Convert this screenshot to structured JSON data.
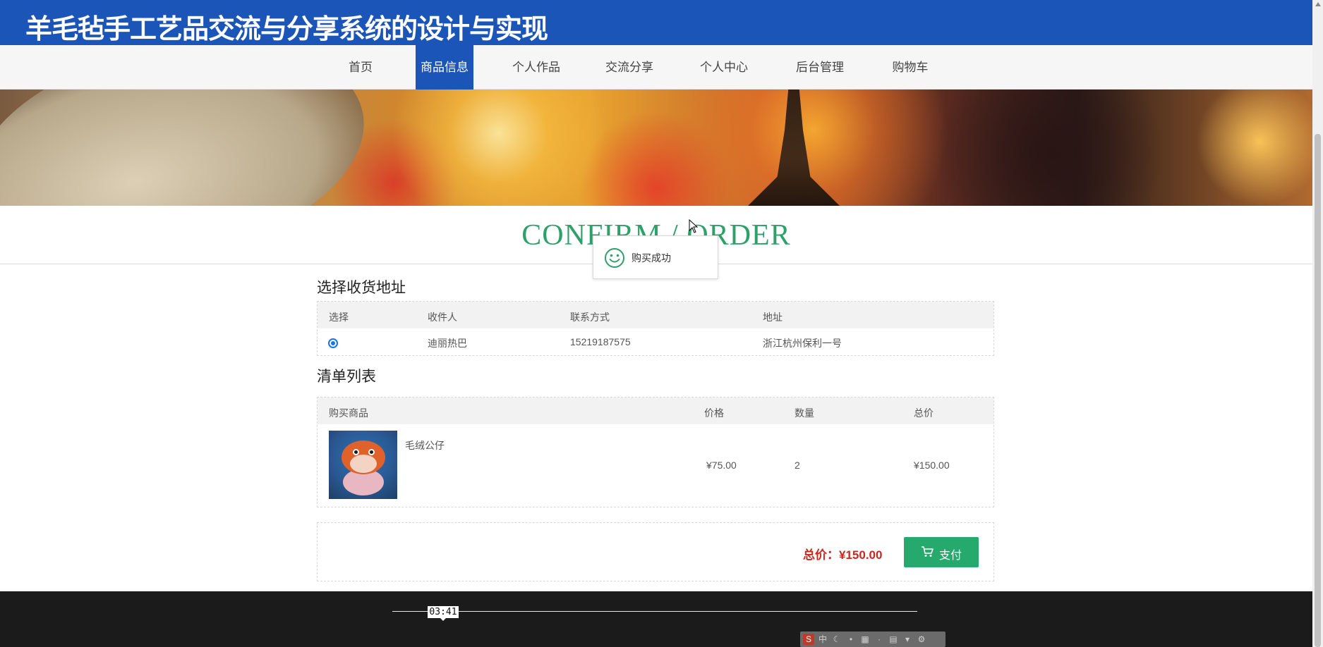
{
  "header": {
    "site_title": "羊毛毡手工艺品交流与分享系统的设计与实现"
  },
  "nav": {
    "items": [
      {
        "label": "首页",
        "active": false
      },
      {
        "label": "商品信息",
        "active": true
      },
      {
        "label": "个人作品",
        "active": false
      },
      {
        "label": "交流分享",
        "active": false
      },
      {
        "label": "个人中心",
        "active": false
      },
      {
        "label": "后台管理",
        "active": false
      },
      {
        "label": "购物车",
        "active": false
      }
    ]
  },
  "page": {
    "title": "CONFIRM / ORDER"
  },
  "toast": {
    "icon": "smiley-icon",
    "message": "购买成功"
  },
  "address_section": {
    "title": "选择收货地址",
    "headers": [
      "选择",
      "收件人",
      "联系方式",
      "地址"
    ],
    "rows": [
      {
        "selected": true,
        "recipient": "迪丽热巴",
        "phone": "15219187575",
        "address": "浙江杭州保利一号"
      }
    ]
  },
  "cart_section": {
    "title": "清单列表",
    "headers": [
      "购买商品",
      "价格",
      "数量",
      "总价"
    ],
    "rows": [
      {
        "name": "毛绒公仔",
        "price": "¥75.00",
        "quantity": "2",
        "subtotal": "¥150.00"
      }
    ]
  },
  "summary": {
    "total_label": "总价：¥150.00",
    "pay_label": "支付",
    "pay_icon": "cart-icon"
  },
  "video": {
    "time": "03:41"
  },
  "ime_toolbar": {
    "lang": "中"
  },
  "colors": {
    "brand_blue": "#1c55b8",
    "accent_green": "#26a96c",
    "title_green": "#2fa06a",
    "price_red": "#c8281e"
  }
}
